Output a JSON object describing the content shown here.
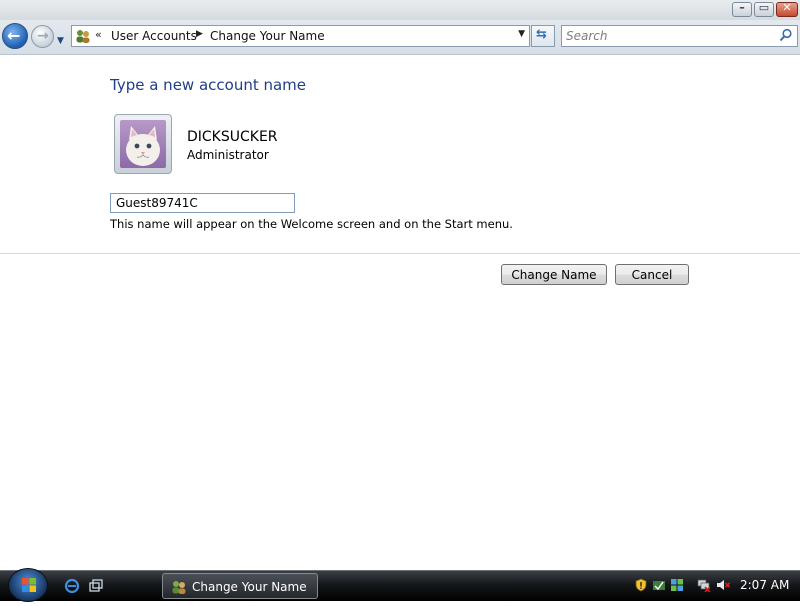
{
  "window": {
    "controls": {
      "minimize": "–",
      "maximize": "▭",
      "close": "✕"
    }
  },
  "nav": {
    "breadcrumb": {
      "overflow": "«",
      "items": [
        "User Accounts",
        "Change Your Name"
      ],
      "separator": "▶"
    },
    "search_placeholder": "Search"
  },
  "main": {
    "heading": "Type a new account name",
    "user": {
      "name": "DICKSUCKER",
      "role": "Administrator"
    },
    "name_input_value": "Guest89741C",
    "hint": "This name will appear on the Welcome screen and on the Start menu.",
    "buttons": {
      "change_name": "Change Name",
      "cancel": "Cancel"
    }
  },
  "taskbar": {
    "task_button_label": "Change Your Name",
    "clock": "2:07 AM"
  },
  "colors": {
    "heading": "#1e3e87",
    "taskbar": "#15181b"
  }
}
